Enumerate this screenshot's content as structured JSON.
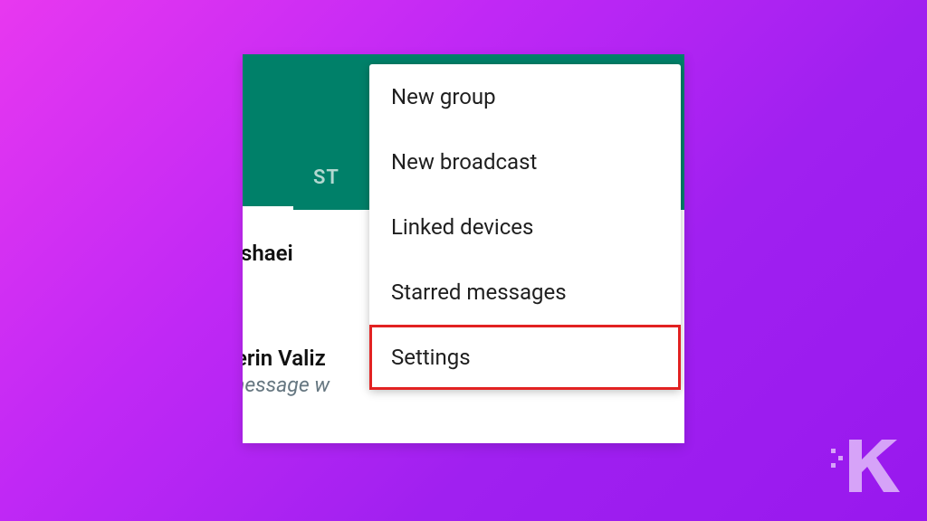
{
  "header": {
    "tab_label_fragment": "ST"
  },
  "chats": {
    "item1": {
      "name_fragment": "shaei"
    },
    "item2": {
      "name_fragment": "erin Valiz",
      "subtitle_fragment": "nessage w"
    }
  },
  "menu": {
    "items": {
      "new_group": "New group",
      "new_broadcast": "New broadcast",
      "linked_devices": "Linked devices",
      "starred_messages": "Starred messages",
      "settings": "Settings"
    }
  },
  "watermark": {
    "letter": "K"
  },
  "colors": {
    "header_bg": "#008069",
    "highlight_border": "#e22222"
  }
}
